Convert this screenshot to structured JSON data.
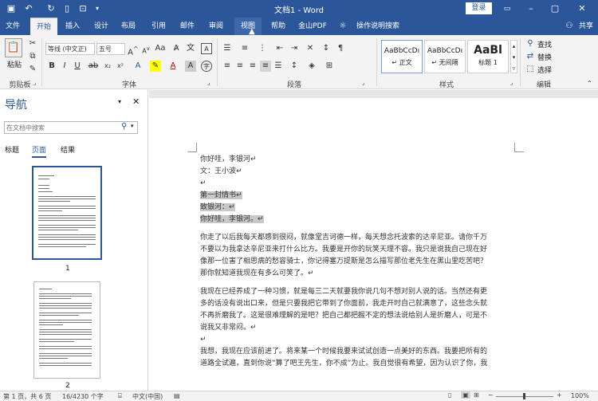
{
  "window": {
    "title": "文档1 - Word",
    "login_label": "登录"
  },
  "qat": {
    "save_icon": "save-icon",
    "undo_icon": "undo-icon",
    "redo_icon": "redo-icon",
    "new_icon": "new-doc-icon",
    "print_icon": "print-preview-icon"
  },
  "tabs": [
    {
      "label": "文件"
    },
    {
      "label": "开始"
    },
    {
      "label": "插入"
    },
    {
      "label": "设计"
    },
    {
      "label": "布局"
    },
    {
      "label": "引用"
    },
    {
      "label": "邮件"
    },
    {
      "label": "审阅"
    },
    {
      "label": "视图"
    },
    {
      "label": "帮助"
    },
    {
      "label": "金山PDF"
    },
    {
      "label": "操作说明搜索"
    },
    {
      "label": "共享"
    }
  ],
  "ribbon": {
    "paste_label": "粘贴",
    "clipboard_label": "剪贴板",
    "font_name": "等线 (中文正)",
    "font_size": "五号",
    "font_label": "字体",
    "paragraph_label": "段落",
    "styles_label": "样式",
    "editing_label": "编辑",
    "styles": [
      {
        "preview": "AaBbCcDı",
        "name": "↵ 正文"
      },
      {
        "preview": "AaBbCcDı",
        "name": "↵ 无间隔"
      },
      {
        "preview": "AaBl",
        "name": "标题 1"
      }
    ],
    "find_label": "查找",
    "replace_label": "替换",
    "select_label": "选择"
  },
  "nav": {
    "title": "导航",
    "search_placeholder": "在文档中搜索",
    "tabs": [
      {
        "label": "标题"
      },
      {
        "label": "页面"
      },
      {
        "label": "结果"
      }
    ],
    "page_numbers": [
      "1",
      "2"
    ]
  },
  "document": {
    "lines": [
      {
        "text": "你好哇，李银河↵",
        "hl": false
      },
      {
        "text": "文：王小波↵",
        "hl": false
      },
      {
        "text": "↵",
        "hl": false
      },
      {
        "text": "第一封情书↵",
        "hl": true
      },
      {
        "text": "致银河：↵",
        "hl": true
      },
      {
        "text": "你好哇，李银河。↵",
        "hl": true
      },
      {
        "text": "",
        "hl": false
      },
      {
        "text": "你走了以后我每天都感到很闷，就像堂吉诃德一样，每天想念托波索的达辛尼亚。请你千万",
        "hl": false
      },
      {
        "text": "不要以为我拿达辛尼亚来打什么比方。我要是开你的玩笑天理不容。我只是说我自己现在好",
        "hl": false
      },
      {
        "text": "像那一位害了相思病的愁容骑士，你记得塞万提斯是怎么描写那位老先生在黑山里吃苦吧？",
        "hl": false
      },
      {
        "text": "那你就知道我现在有多么可笑了。↵",
        "hl": false
      },
      {
        "text": "",
        "hl": false
      },
      {
        "text": "我现在已经养成了一种习惯，就是每三二天就要我你说几句不想对别人说的话。当然还有更",
        "hl": false
      },
      {
        "text": "多的话没有说出口来，但是只要我把它带到了你面前，我走开时自己就满意了，这些念头就",
        "hl": false
      },
      {
        "text": "不再折磨我了。这是很难理解的是吧？把自己都把握不定的想法说给别人是折磨人，可是不",
        "hl": false
      },
      {
        "text": "说我又非常闷。↵",
        "hl": false
      },
      {
        "text": "↵",
        "hl": false
      },
      {
        "text": "我想，我现在应该前进了。将来某一个时候我要来试试创造一点美好的东西。我要把所有的",
        "hl": false
      },
      {
        "text": "道路全试遍，直到你说“算了吧王先生，你不成”为止。我自觉很有希望，因为认识了你，我",
        "hl": false
      }
    ]
  },
  "status": {
    "page": "第 1 页，共 6 页",
    "words": "16/4230 个字",
    "language": "中文(中国)",
    "zoom": "100%"
  }
}
